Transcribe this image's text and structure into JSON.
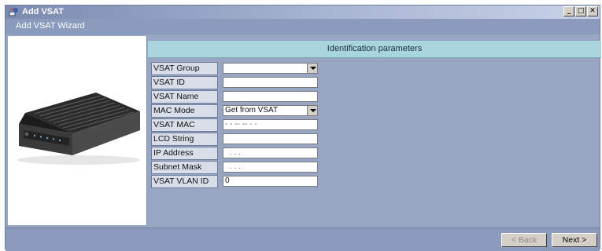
{
  "window": {
    "title": "Add VSAT",
    "controls": [
      "_",
      "□",
      "✕"
    ]
  },
  "wizard": {
    "title": "Add VSAT Wizard"
  },
  "section": {
    "title": "Identification parameters"
  },
  "form": {
    "fields": [
      {
        "label": "VSAT Group",
        "value": "",
        "type": "select"
      },
      {
        "label": "VSAT ID",
        "value": "",
        "type": "text"
      },
      {
        "label": "VSAT Name",
        "value": "",
        "type": "text"
      },
      {
        "label": "MAC Mode",
        "value": "Get from VSAT",
        "type": "select"
      },
      {
        "label": "VSAT MAC Address",
        "value": "- - -- -- - -",
        "type": "text"
      },
      {
        "label": "LCD String",
        "value": "",
        "type": "text"
      },
      {
        "label": "IP Address",
        "value": ". . .",
        "type": "text"
      },
      {
        "label": "Subnet Mask",
        "value": ". . .",
        "type": "text"
      },
      {
        "label": "VSAT VLAN ID",
        "value": "0",
        "type": "text"
      }
    ]
  },
  "footer": {
    "back_label": "< Back",
    "next_label": "Next >"
  }
}
